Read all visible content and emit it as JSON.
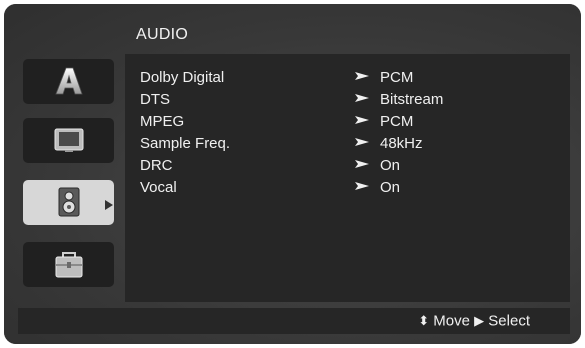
{
  "menu": {
    "title": "AUDIO",
    "icons": [
      "language-icon",
      "display-icon",
      "speaker-icon",
      "lock-icon"
    ],
    "active_index": 2,
    "items": [
      {
        "label": "Dolby Digital",
        "value": "PCM"
      },
      {
        "label": "DTS",
        "value": "Bitstream"
      },
      {
        "label": "MPEG",
        "value": "PCM"
      },
      {
        "label": "Sample Freq.",
        "value": "48kHz"
      },
      {
        "label": "DRC",
        "value": "On"
      },
      {
        "label": "Vocal",
        "value": "On"
      }
    ]
  },
  "footer": {
    "move_glyph": "⬍",
    "move_label": "Move",
    "select_glyph": "▶",
    "select_label": "Select"
  },
  "colors": {
    "background": "#3d3d3d",
    "panel": "#262626",
    "active_tile": "#d7d7d7",
    "text": "#f0f0f0"
  }
}
